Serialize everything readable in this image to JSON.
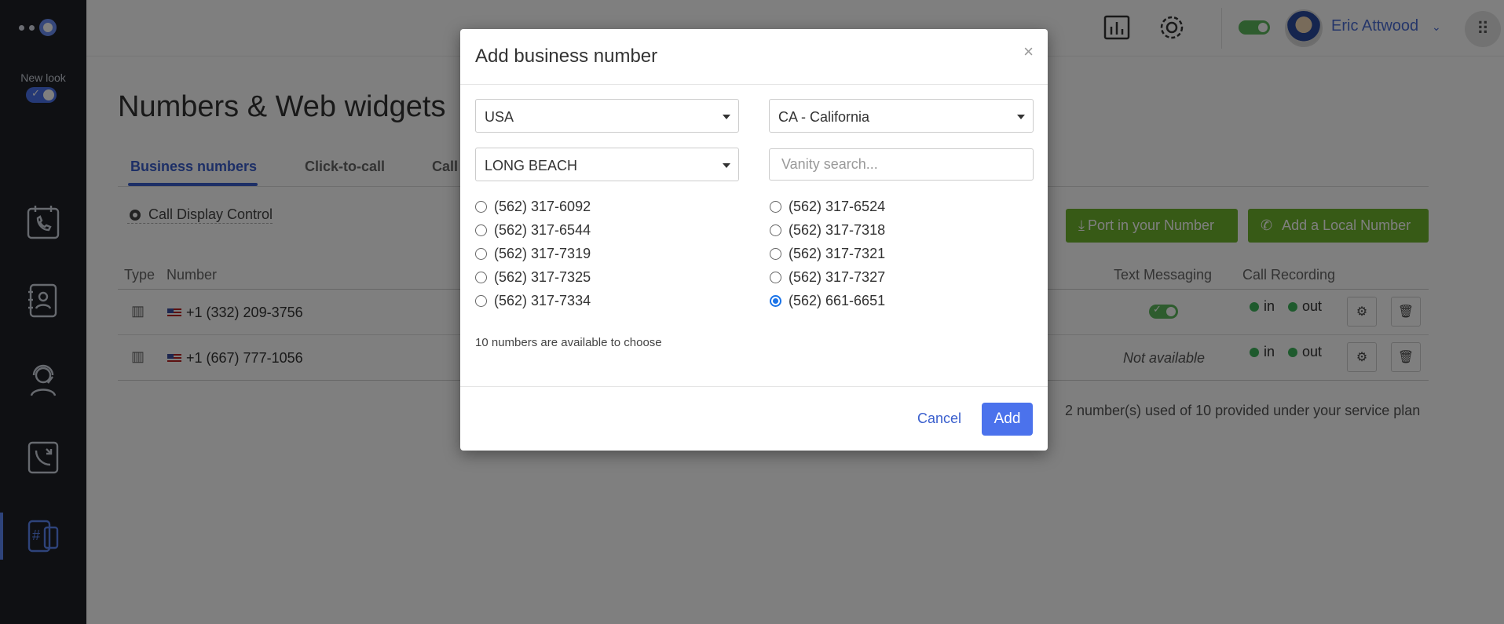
{
  "sidebar": {
    "new_look_label": "New look",
    "items": [
      {
        "name": "calls-calendar",
        "icon": "phone-calendar-icon"
      },
      {
        "name": "contacts",
        "icon": "contact-book-icon"
      },
      {
        "name": "agents",
        "icon": "headset-agent-icon"
      },
      {
        "name": "call-flow",
        "icon": "call-transfer-icon"
      },
      {
        "name": "numbers",
        "icon": "hash-phone-icon",
        "active": true
      }
    ]
  },
  "header": {
    "user_name": "Eric Attwood"
  },
  "page": {
    "title": "Numbers & Web widgets",
    "tabs": [
      "Business numbers",
      "Click-to-call",
      "Call"
    ],
    "call_display_control": "Call Display Control",
    "port_button": "Port in your Number",
    "add_local_button": "Add a Local Number",
    "table": {
      "headers": {
        "type": "Type",
        "number": "Number",
        "text_messaging": "Text Messaging",
        "call_recording": "Call Recording"
      },
      "rows": [
        {
          "number": "+1 (332) 209-3756",
          "text_messaging": "on",
          "rec_in": "in",
          "rec_out": "out"
        },
        {
          "number": "+1 (667) 777-1056",
          "text_messaging": "Not available",
          "rec_in": "in",
          "rec_out": "out"
        }
      ]
    },
    "usage_text": "2 number(s) used of 10 provided under your service plan"
  },
  "modal": {
    "title": "Add business number",
    "close": "×",
    "country": "USA",
    "state": "CA - California",
    "city": "LONG BEACH",
    "vanity_placeholder": "Vanity search...",
    "numbers_left": [
      "(562) 317-6092",
      "(562) 317-6544",
      "(562) 317-7319",
      "(562) 317-7325",
      "(562) 317-7334"
    ],
    "numbers_right": [
      "(562) 317-6524",
      "(562) 317-7318",
      "(562) 317-7321",
      "(562) 317-7327",
      "(562) 661-6651"
    ],
    "selected": "(562) 661-6651",
    "available_note": "10 numbers are available to choose",
    "cancel_label": "Cancel",
    "add_label": "Add"
  },
  "colors": {
    "accent": "#4b72ec",
    "green": "#6fb52c",
    "sidebar": "#1e2127"
  }
}
